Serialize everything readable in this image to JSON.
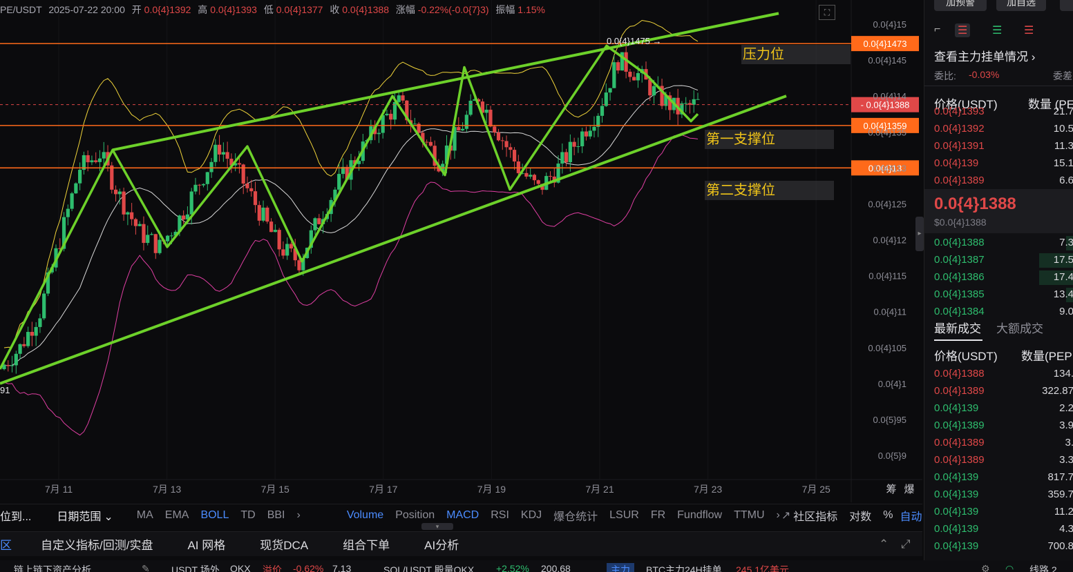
{
  "ohlc_bar": {
    "pair": "PE/USDT",
    "datetime": "2025-07-22 20:00",
    "open_label": "开",
    "open": "0.0{4}1392",
    "high_label": "高",
    "high": "0.0{4}1393",
    "low_label": "低",
    "low": "0.0{4}1377",
    "close_label": "收",
    "close": "0.0{4}1388",
    "change_label": "涨幅",
    "change": "-0.22%(-0.0{7}3)",
    "amplitude_label": "振幅",
    "amplitude": "1.15%"
  },
  "price_axis": {
    "ticks": [
      "0.0{4}15",
      "0.0{4}145",
      "0.0{4}14",
      "0.0{4}135",
      "0.0{4}13",
      "0.0{4}125",
      "0.0{4}12",
      "0.0{4}115",
      "0.0{4}11",
      "0.0{4}105",
      "0.0{4}1",
      "0.0{5}95",
      "0.0{5}9"
    ],
    "tags": {
      "resistance": "0.0{4}1473",
      "current": "0.0{4}1388",
      "support1": "0.0{4}1359",
      "support2": "0.0{4}13"
    }
  },
  "time_axis": [
    "7月 11",
    "7月 13",
    "7月 15",
    "7月 17",
    "7月 19",
    "7月 21",
    "7月 23",
    "7月 25"
  ],
  "time_axis_right": [
    "筹",
    "爆"
  ],
  "annotations": {
    "resistance": "压力位",
    "support1": "第一支撑位",
    "support2": "第二支撑位",
    "high_marker": "0.0{4}1475 →",
    "left_cut_label": "91"
  },
  "colors": {
    "up": "#2ebd6e",
    "down": "#e04848",
    "level_line": "#ff6a1a",
    "trend_line": "#6dd12a",
    "annotation": "#f0c419",
    "accent": "#4b8cff"
  },
  "chart_data": {
    "type": "candlestick",
    "pair": "PE/USDT",
    "unit": "USDT (×1e-5)",
    "ylim": [
      0.88,
      1.53
    ],
    "x_ticks": [
      "7月 11",
      "7月 13",
      "7月 15",
      "7月 17",
      "7月 19",
      "7月 21",
      "7月 23",
      "7月 25"
    ],
    "close_path": [
      1.02,
      1.05,
      1.1,
      1.2,
      1.3,
      1.32,
      1.26,
      1.21,
      1.19,
      1.23,
      1.28,
      1.33,
      1.29,
      1.24,
      1.19,
      1.17,
      1.23,
      1.28,
      1.32,
      1.36,
      1.39,
      1.35,
      1.31,
      1.35,
      1.4,
      1.35,
      1.3,
      1.27,
      1.3,
      1.34,
      1.38,
      1.45,
      1.43,
      1.4,
      1.38,
      1.39
    ],
    "indicators": [
      "BOLL"
    ],
    "levels": [
      {
        "name": "压力位",
        "value": 1.473
      },
      {
        "name": "第一支撑位",
        "value": 1.359
      },
      {
        "name": "第二支撑位",
        "value": 1.3
      }
    ],
    "last_price": 1.388,
    "period_high": 1.475
  },
  "toolbar": {
    "left_cut": "位到...",
    "range": "日期范围",
    "main_indicators": [
      "MA",
      "EMA",
      "BOLL",
      "TD",
      "BBI"
    ],
    "sub_indicators": [
      "Volume",
      "Position",
      "MACD",
      "RSI",
      "KDJ",
      "爆仓统计",
      "LSUR",
      "FR",
      "Fundflow",
      "TTMU"
    ],
    "community": "社区指标",
    "log": "对数",
    "percent": "%",
    "auto": "自动"
  },
  "bottom_tabs": [
    "区",
    "自定义指标/回测/实盘",
    "AI 网格",
    "现货DCA",
    "组合下单",
    "AI分析"
  ],
  "ticker": {
    "item1": "链上链下资产分析",
    "item2": "USDT 场外",
    "item2_exch": "OKX",
    "item2_tag": "溢价",
    "item2_pct": "-0.62%",
    "item2_val": "7.13",
    "item3": "SOL/USDT 殿量OKX",
    "item3_pct": "+2.52%",
    "item3_val": "200.68",
    "item4_tag": "主力",
    "item4": "BTC主力24H挂单",
    "item4_val": "245.1亿美元",
    "item5": "线路 2"
  },
  "right_panel": {
    "btn1": "加预警",
    "btn2": "加自选",
    "depth_link": "查看主力挂单情况",
    "ratio_label": "委比:",
    "ratio_value": "-0.03%",
    "diff_label": "委差",
    "col_price": "价格(USDT)",
    "col_qty": "数量 (PE",
    "asks": [
      {
        "price": "0.0{4}1393",
        "qty": "21.7"
      },
      {
        "price": "0.0{4}1392",
        "qty": "10.5"
      },
      {
        "price": "0.0{4}1391",
        "qty": "11.3"
      },
      {
        "price": "0.0{4}139",
        "qty": "15.1"
      },
      {
        "price": "0.0{4}1389",
        "qty": "6.6"
      }
    ],
    "last_price": "0.0{4}1388",
    "last_price_usd": "$0.0{4}1388",
    "bids": [
      {
        "price": "0.0{4}1388",
        "qty": "7.3",
        "depth": 0.05
      },
      {
        "price": "0.0{4}1387",
        "qty": "17.5",
        "depth": 0.23
      },
      {
        "price": "0.0{4}1386",
        "qty": "17.4",
        "depth": 0.23
      },
      {
        "price": "0.0{4}1385",
        "qty": "13.4",
        "depth": 0.05
      },
      {
        "price": "0.0{4}1384",
        "qty": "9.0",
        "depth": 0.0
      }
    ],
    "trades_tab": "最新成交",
    "large_trades_tab": "大额成交",
    "trades_col_price": "价格(USDT)",
    "trades_col_qty": "数量(PEP",
    "trades": [
      {
        "price": "0.0{4}1388",
        "qty": "134.",
        "side": "sell"
      },
      {
        "price": "0.0{4}1389",
        "qty": "322.87",
        "side": "sell"
      },
      {
        "price": "0.0{4}139",
        "qty": "2.2",
        "side": "buy"
      },
      {
        "price": "0.0{4}1389",
        "qty": "3.9",
        "side": "buy"
      },
      {
        "price": "0.0{4}1389",
        "qty": "3.",
        "side": "sell"
      },
      {
        "price": "0.0{4}1389",
        "qty": "3.3",
        "side": "sell"
      },
      {
        "price": "0.0{4}139",
        "qty": "817.7",
        "side": "buy"
      },
      {
        "price": "0.0{4}139",
        "qty": "359.7",
        "side": "buy"
      },
      {
        "price": "0.0{4}139",
        "qty": "11.2",
        "side": "buy"
      },
      {
        "price": "0.0{4}139",
        "qty": "4.3",
        "side": "buy"
      },
      {
        "price": "0.0{4}139",
        "qty": "700.8",
        "side": "buy"
      }
    ]
  }
}
